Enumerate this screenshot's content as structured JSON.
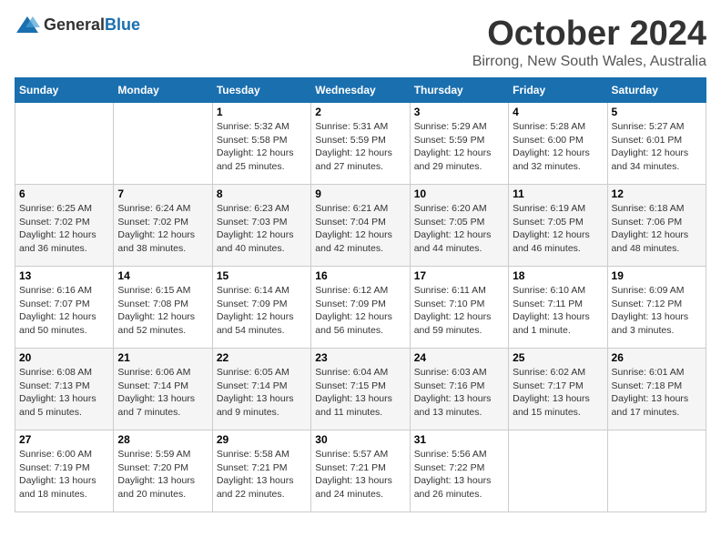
{
  "header": {
    "logo_general": "General",
    "logo_blue": "Blue",
    "title": "October 2024",
    "location": "Birrong, New South Wales, Australia"
  },
  "days_of_week": [
    "Sunday",
    "Monday",
    "Tuesday",
    "Wednesday",
    "Thursday",
    "Friday",
    "Saturday"
  ],
  "weeks": [
    [
      {
        "day": null,
        "info": null
      },
      {
        "day": null,
        "info": null
      },
      {
        "day": "1",
        "info": "Sunrise: 5:32 AM\nSunset: 5:58 PM\nDaylight: 12 hours\nand 25 minutes."
      },
      {
        "day": "2",
        "info": "Sunrise: 5:31 AM\nSunset: 5:59 PM\nDaylight: 12 hours\nand 27 minutes."
      },
      {
        "day": "3",
        "info": "Sunrise: 5:29 AM\nSunset: 5:59 PM\nDaylight: 12 hours\nand 29 minutes."
      },
      {
        "day": "4",
        "info": "Sunrise: 5:28 AM\nSunset: 6:00 PM\nDaylight: 12 hours\nand 32 minutes."
      },
      {
        "day": "5",
        "info": "Sunrise: 5:27 AM\nSunset: 6:01 PM\nDaylight: 12 hours\nand 34 minutes."
      }
    ],
    [
      {
        "day": "6",
        "info": "Sunrise: 6:25 AM\nSunset: 7:02 PM\nDaylight: 12 hours\nand 36 minutes."
      },
      {
        "day": "7",
        "info": "Sunrise: 6:24 AM\nSunset: 7:02 PM\nDaylight: 12 hours\nand 38 minutes."
      },
      {
        "day": "8",
        "info": "Sunrise: 6:23 AM\nSunset: 7:03 PM\nDaylight: 12 hours\nand 40 minutes."
      },
      {
        "day": "9",
        "info": "Sunrise: 6:21 AM\nSunset: 7:04 PM\nDaylight: 12 hours\nand 42 minutes."
      },
      {
        "day": "10",
        "info": "Sunrise: 6:20 AM\nSunset: 7:05 PM\nDaylight: 12 hours\nand 44 minutes."
      },
      {
        "day": "11",
        "info": "Sunrise: 6:19 AM\nSunset: 7:05 PM\nDaylight: 12 hours\nand 46 minutes."
      },
      {
        "day": "12",
        "info": "Sunrise: 6:18 AM\nSunset: 7:06 PM\nDaylight: 12 hours\nand 48 minutes."
      }
    ],
    [
      {
        "day": "13",
        "info": "Sunrise: 6:16 AM\nSunset: 7:07 PM\nDaylight: 12 hours\nand 50 minutes."
      },
      {
        "day": "14",
        "info": "Sunrise: 6:15 AM\nSunset: 7:08 PM\nDaylight: 12 hours\nand 52 minutes."
      },
      {
        "day": "15",
        "info": "Sunrise: 6:14 AM\nSunset: 7:09 PM\nDaylight: 12 hours\nand 54 minutes."
      },
      {
        "day": "16",
        "info": "Sunrise: 6:12 AM\nSunset: 7:09 PM\nDaylight: 12 hours\nand 56 minutes."
      },
      {
        "day": "17",
        "info": "Sunrise: 6:11 AM\nSunset: 7:10 PM\nDaylight: 12 hours\nand 59 minutes."
      },
      {
        "day": "18",
        "info": "Sunrise: 6:10 AM\nSunset: 7:11 PM\nDaylight: 13 hours\nand 1 minute."
      },
      {
        "day": "19",
        "info": "Sunrise: 6:09 AM\nSunset: 7:12 PM\nDaylight: 13 hours\nand 3 minutes."
      }
    ],
    [
      {
        "day": "20",
        "info": "Sunrise: 6:08 AM\nSunset: 7:13 PM\nDaylight: 13 hours\nand 5 minutes."
      },
      {
        "day": "21",
        "info": "Sunrise: 6:06 AM\nSunset: 7:14 PM\nDaylight: 13 hours\nand 7 minutes."
      },
      {
        "day": "22",
        "info": "Sunrise: 6:05 AM\nSunset: 7:14 PM\nDaylight: 13 hours\nand 9 minutes."
      },
      {
        "day": "23",
        "info": "Sunrise: 6:04 AM\nSunset: 7:15 PM\nDaylight: 13 hours\nand 11 minutes."
      },
      {
        "day": "24",
        "info": "Sunrise: 6:03 AM\nSunset: 7:16 PM\nDaylight: 13 hours\nand 13 minutes."
      },
      {
        "day": "25",
        "info": "Sunrise: 6:02 AM\nSunset: 7:17 PM\nDaylight: 13 hours\nand 15 minutes."
      },
      {
        "day": "26",
        "info": "Sunrise: 6:01 AM\nSunset: 7:18 PM\nDaylight: 13 hours\nand 17 minutes."
      }
    ],
    [
      {
        "day": "27",
        "info": "Sunrise: 6:00 AM\nSunset: 7:19 PM\nDaylight: 13 hours\nand 18 minutes."
      },
      {
        "day": "28",
        "info": "Sunrise: 5:59 AM\nSunset: 7:20 PM\nDaylight: 13 hours\nand 20 minutes."
      },
      {
        "day": "29",
        "info": "Sunrise: 5:58 AM\nSunset: 7:21 PM\nDaylight: 13 hours\nand 22 minutes."
      },
      {
        "day": "30",
        "info": "Sunrise: 5:57 AM\nSunset: 7:21 PM\nDaylight: 13 hours\nand 24 minutes."
      },
      {
        "day": "31",
        "info": "Sunrise: 5:56 AM\nSunset: 7:22 PM\nDaylight: 13 hours\nand 26 minutes."
      },
      {
        "day": null,
        "info": null
      },
      {
        "day": null,
        "info": null
      }
    ]
  ]
}
